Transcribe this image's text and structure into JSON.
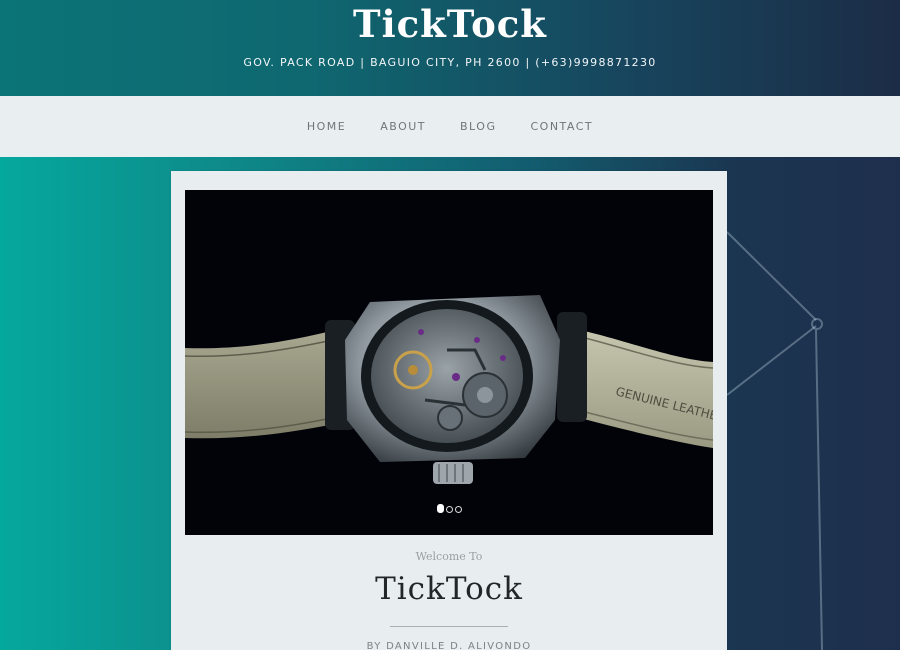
{
  "header": {
    "title": "TickTock",
    "info": "GOV. PACK ROAD | BAGUIO CITY, PH 2600 | (+63)9998871230"
  },
  "nav": {
    "items": [
      {
        "label": "HOME"
      },
      {
        "label": "ABOUT"
      },
      {
        "label": "BLOG"
      },
      {
        "label": "CONTACT"
      }
    ]
  },
  "slider": {
    "image": "watch-photo",
    "slide_count": 3,
    "active_slide": 1
  },
  "welcome": {
    "label": "Welcome To",
    "title": "TickTock",
    "byline": "BY DANVILLE D. ALIVONDO"
  },
  "colors": {
    "background_start": "#05a89d",
    "background_end": "#1e2f4d",
    "nav_bg": "#e9eef1",
    "card_bg": "#e8eef0"
  }
}
